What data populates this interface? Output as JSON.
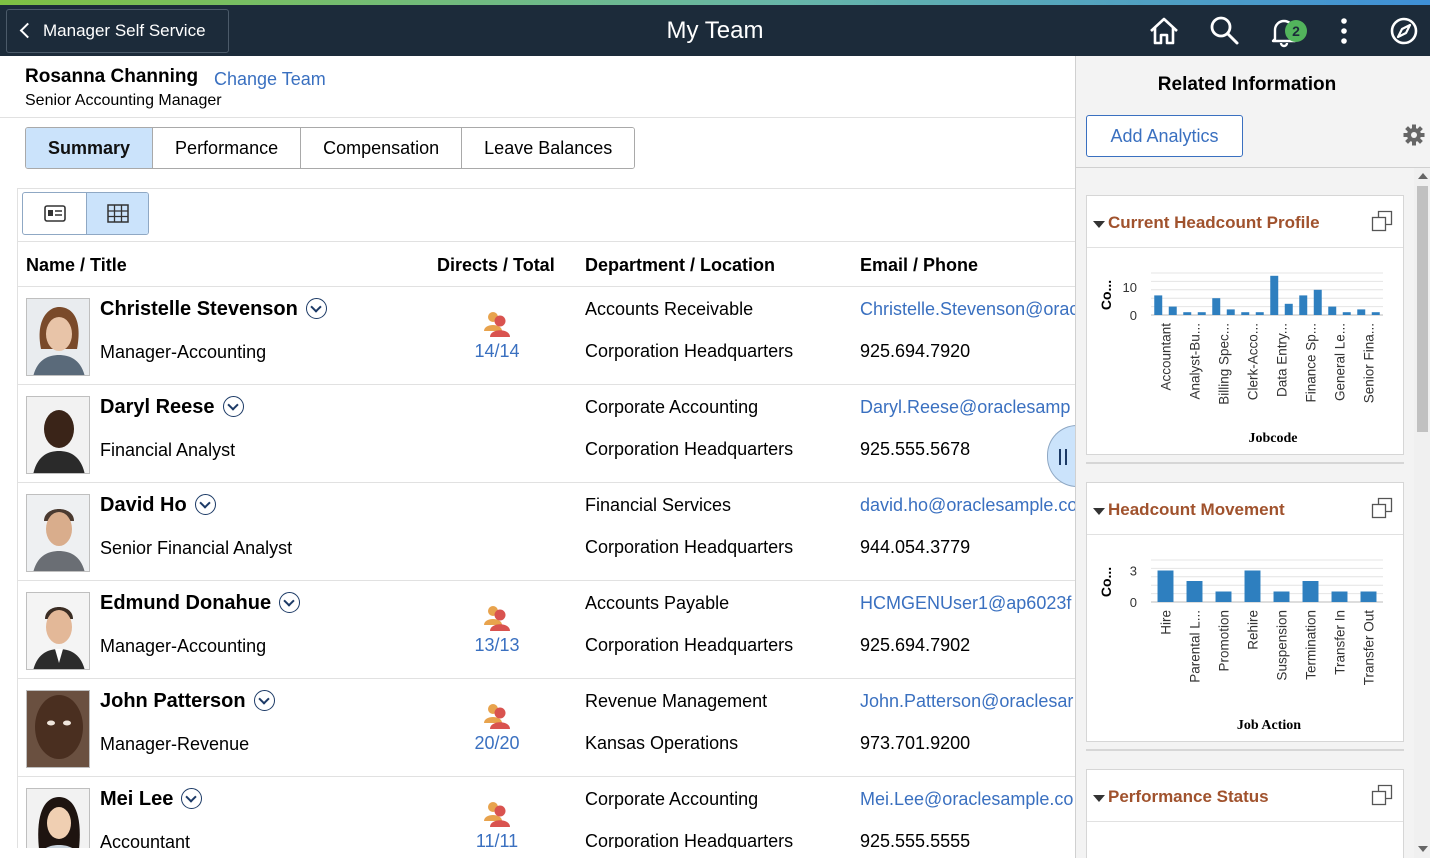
{
  "header": {
    "back_label": "Manager Self Service",
    "page_title": "My Team",
    "notification_count": "2",
    "icons": [
      "home-icon",
      "search-icon",
      "bell-icon",
      "more-icon",
      "compass-icon"
    ]
  },
  "manager": {
    "name": "Rosanna Channing",
    "change_team_label": "Change Team",
    "title": "Senior Accounting Manager"
  },
  "tabs": [
    {
      "label": "Summary",
      "active": true
    },
    {
      "label": "Performance",
      "active": false
    },
    {
      "label": "Compensation",
      "active": false
    },
    {
      "label": "Leave Balances",
      "active": false
    }
  ],
  "view_toggle": {
    "selected": "grid"
  },
  "columns": {
    "name": "Name / Title",
    "directs": "Directs / Total",
    "dept": "Department / Location",
    "email": "Email / Phone"
  },
  "employees": [
    {
      "name": "Christelle Stevenson",
      "title": "Manager-Accounting",
      "directs": "14/14",
      "dept": "Accounts Receivable",
      "location": "Corporation Headquarters",
      "email": "Christelle.Stevenson@orac",
      "phone": "925.694.7920"
    },
    {
      "name": "Daryl Reese",
      "title": "Financial Analyst",
      "directs": "",
      "dept": "Corporate Accounting",
      "location": "Corporation Headquarters",
      "email": "Daryl.Reese@oraclesamp",
      "phone": "925.555.5678"
    },
    {
      "name": "David Ho",
      "title": "Senior Financial Analyst",
      "directs": "",
      "dept": "Financial Services",
      "location": "Corporation Headquarters",
      "email": "david.ho@oraclesample.co",
      "phone": "944.054.3779"
    },
    {
      "name": "Edmund Donahue",
      "title": "Manager-Accounting",
      "directs": "13/13",
      "dept": "Accounts Payable",
      "location": "Corporation Headquarters",
      "email": "HCMGENUser1@ap6023f",
      "phone": "925.694.7902"
    },
    {
      "name": "John Patterson",
      "title": "Manager-Revenue",
      "directs": "20/20",
      "dept": "Revenue Management",
      "location": "Kansas Operations",
      "email": "John.Patterson@oraclesar",
      "phone": "973.701.9200"
    },
    {
      "name": "Mei Lee",
      "title": "Accountant",
      "directs": "11/11",
      "dept": "Corporate Accounting",
      "location": "Corporation Headquarters",
      "email": "Mei.Lee@oraclesample.co",
      "phone": "925.555.5555"
    }
  ],
  "panel": {
    "title": "Related Information",
    "add_analytics_label": "Add Analytics",
    "cards": [
      {
        "title": "Current Headcount Profile"
      },
      {
        "title": "Headcount Movement"
      },
      {
        "title": "Performance Status"
      }
    ]
  },
  "colors": {
    "bar": "#2e7fbf",
    "link": "#3a70c0",
    "card_title": "#a0522d",
    "topbar": "#1c2b3a",
    "active_tab": "#cbe3fb"
  },
  "chart_data": [
    {
      "type": "bar",
      "title": "Current Headcount Profile",
      "xlabel": "Jobcode",
      "ylabel": "Co...",
      "yticks": [
        "10",
        "0"
      ],
      "ylim": [
        0,
        15
      ],
      "grid": true,
      "tick_labels": [
        "Accountant",
        "Analyst-Bu...",
        "Billing Spec...",
        "Clerk-Acco...",
        "Data Entry...",
        "Finance Sp...",
        "General Le...",
        "Senior Fina..."
      ],
      "values": [
        7,
        3,
        1,
        1,
        6,
        2,
        1,
        1,
        14,
        4,
        7,
        9,
        3,
        1,
        2,
        1
      ]
    },
    {
      "type": "bar",
      "title": "Headcount Movement",
      "xlabel": "Job Action",
      "ylabel": "Co...",
      "yticks": [
        "3",
        "0"
      ],
      "ylim": [
        0,
        4
      ],
      "grid": true,
      "categories": [
        "Hire",
        "Parental L...",
        "Promotion",
        "Rehire",
        "Suspension",
        "Termination",
        "Transfer In",
        "Transfer Out"
      ],
      "values": [
        3,
        2,
        1,
        3,
        1,
        2,
        1,
        1
      ]
    }
  ]
}
